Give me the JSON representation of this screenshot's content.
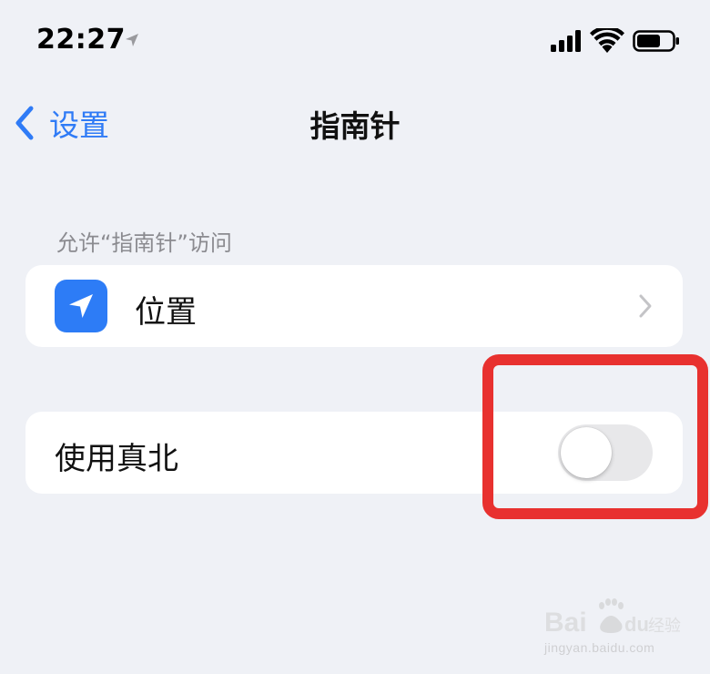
{
  "status_bar": {
    "time": "22:27",
    "icons": [
      "location-arrow-icon",
      "cellular-signal-icon",
      "wifi-icon",
      "battery-icon"
    ]
  },
  "nav": {
    "back_label": "设置",
    "title": "指南针",
    "back_icon": "chevron-left-icon"
  },
  "section": {
    "header": "允许“指南针”访问"
  },
  "location_row": {
    "label": "位置",
    "icon": "location-arrow-icon",
    "accessory": "chevron-right-icon"
  },
  "true_north_row": {
    "label": "使用真北",
    "toggle_on": false
  },
  "watermark": {
    "text": "Bai du 经验",
    "url": "jingyan.baidu.com"
  },
  "colors": {
    "background": "#eff1f6",
    "accent": "#2f7bf6",
    "highlight": "#e8312f",
    "toggle_off": "#e8e8ea"
  }
}
